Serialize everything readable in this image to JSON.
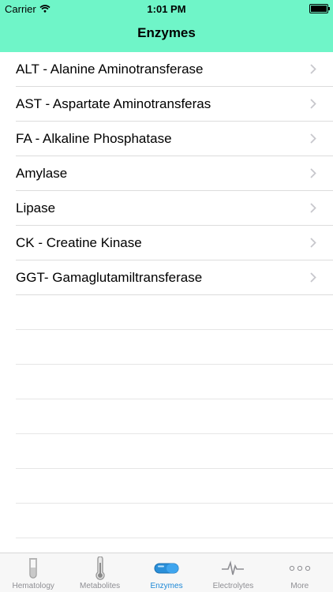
{
  "status": {
    "carrier": "Carrier",
    "time": "1:01 PM"
  },
  "nav": {
    "title": "Enzymes"
  },
  "items": [
    {
      "label": "ALT - Alanine Aminotransferase"
    },
    {
      "label": "AST - Aspartate Aminotransferas"
    },
    {
      "label": "FA - Alkaline Phosphatase"
    },
    {
      "label": "Amylase"
    },
    {
      "label": "Lipase"
    },
    {
      "label": "CK - Creatine Kinase"
    },
    {
      "label": "GGT- Gamaglutamiltransferase"
    }
  ],
  "tabs": [
    {
      "label": "Hematology",
      "icon": "test-tube-icon"
    },
    {
      "label": "Metabolites",
      "icon": "thermometer-icon"
    },
    {
      "label": "Enzymes",
      "icon": "capsule-icon",
      "active": true
    },
    {
      "label": "Electrolytes",
      "icon": "pulse-icon"
    },
    {
      "label": "More",
      "icon": "more-dots-icon"
    }
  ],
  "colors": {
    "accent": "#6ff5c8",
    "tab_active": "#1b87d6",
    "tab_inactive": "#8e8e93"
  }
}
